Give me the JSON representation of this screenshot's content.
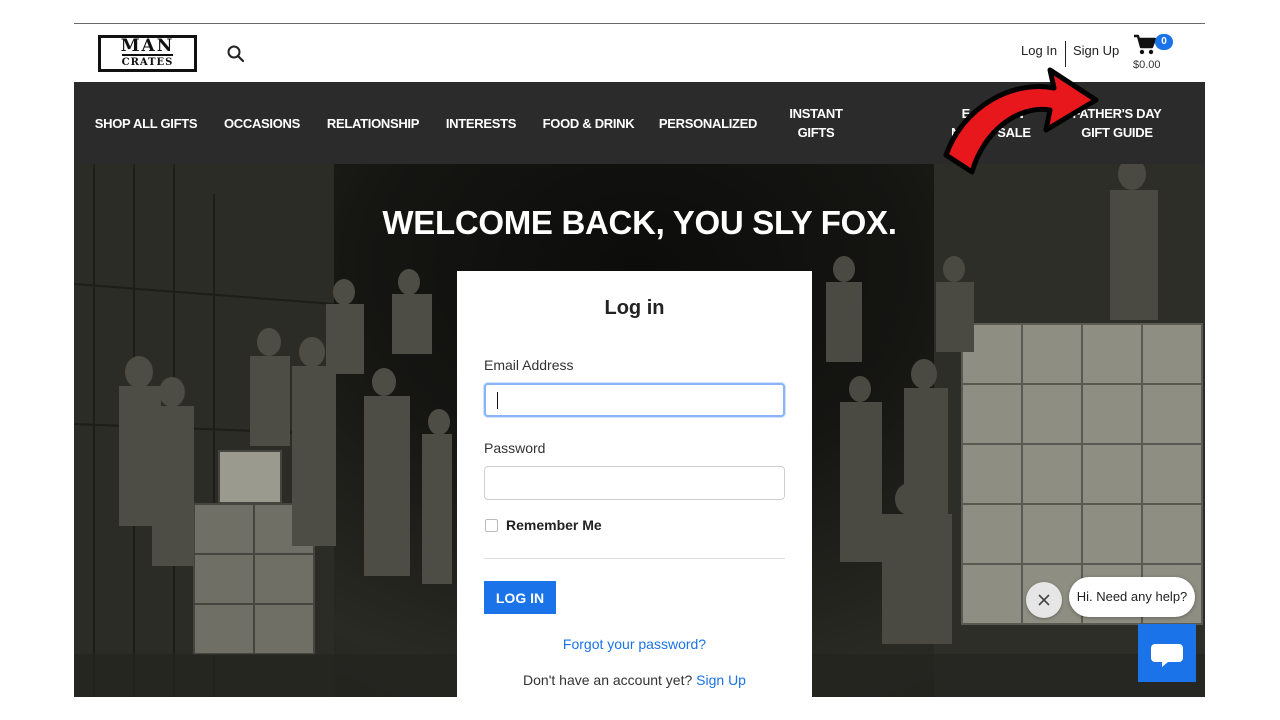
{
  "header": {
    "logo_top": "MAN",
    "logo_bottom": "CRATES",
    "login_label": "Log In",
    "signup_label": "Sign Up",
    "cart_count": "0",
    "cart_total": "$0.00"
  },
  "nav": {
    "items": [
      {
        "line1": "SHOP ALL GIFTS",
        "line2": ""
      },
      {
        "line1": "OCCASIONS",
        "line2": ""
      },
      {
        "line1": "RELATIONSHIP",
        "line2": ""
      },
      {
        "line1": "INTERESTS",
        "line2": ""
      },
      {
        "line1": "FOOD & DRINK",
        "line2": ""
      },
      {
        "line1": "PERSONALIZED",
        "line2": ""
      },
      {
        "line1": "INSTANT",
        "line2": "GIFTS"
      },
      {
        "line1": "E",
        "line2": "NG"
      },
      {
        "line1": "ON",
        "line2": "SALE"
      },
      {
        "line1": "FATHER'S DAY",
        "line2": "GIFT GUIDE"
      }
    ]
  },
  "hero": {
    "title": "WELCOME BACK, YOU SLY FOX."
  },
  "login_form": {
    "title": "Log in",
    "email_label": "Email Address",
    "email_value": "",
    "password_label": "Password",
    "password_value": "",
    "remember_label": "Remember Me",
    "submit_label": "LOG IN",
    "forgot_label": "Forgot your password?",
    "no_account_text": "Don't have an account yet?",
    "signup_link": "Sign Up"
  },
  "chat": {
    "prompt": "Hi. Need any help?"
  },
  "colors": {
    "accent": "#1a73e8",
    "nav_bg": "#2b2b2b",
    "arrow": "#e8171b"
  }
}
